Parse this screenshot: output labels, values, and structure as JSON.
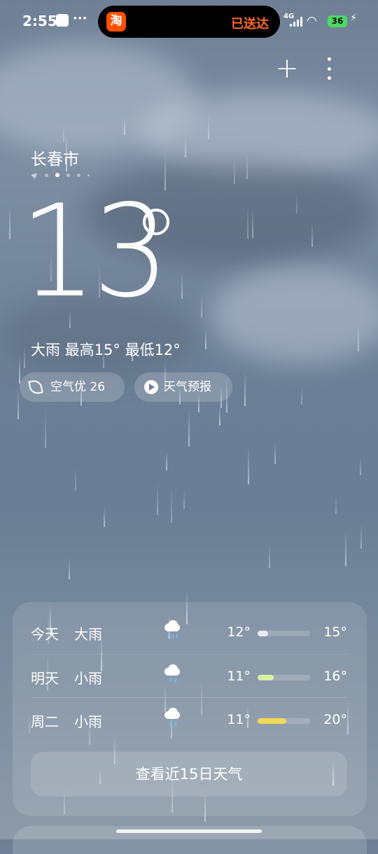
{
  "status_bar": {
    "time": "2:55",
    "dots": "···",
    "island_app_icon": "淘",
    "island_text": "已送达",
    "network": "4G",
    "battery": "36"
  },
  "top_actions": {
    "add_icon": "plus-icon",
    "more_icon": "more-vertical-icon"
  },
  "location": {
    "city": "长春市",
    "pages_total": 5,
    "current_page_index": 2
  },
  "current": {
    "temperature": "13",
    "description": "大雨  最高15°  最低12°"
  },
  "pills": {
    "air_quality": "空气优 26",
    "forecast": "天气预报"
  },
  "forecast": [
    {
      "day": "今天",
      "condition": "大雨",
      "icon": "heavy-rain-icon",
      "low": "12°",
      "high": "15°",
      "bar_start": 0.0,
      "bar_end": 0.2,
      "bar_color": "#e9eef5"
    },
    {
      "day": "明天",
      "condition": "小雨",
      "icon": "light-rain-icon",
      "low": "11°",
      "high": "16°",
      "bar_start": 0.0,
      "bar_end": 0.3,
      "bar_color": "#d8f0a4"
    },
    {
      "day": "周二",
      "condition": "小雨",
      "icon": "light-rain-icon",
      "low": "11°",
      "high": "20°",
      "bar_start": 0.0,
      "bar_end": 0.55,
      "bar_color": "#f3d85a"
    }
  ],
  "cta": {
    "label": "查看近15日天气"
  }
}
